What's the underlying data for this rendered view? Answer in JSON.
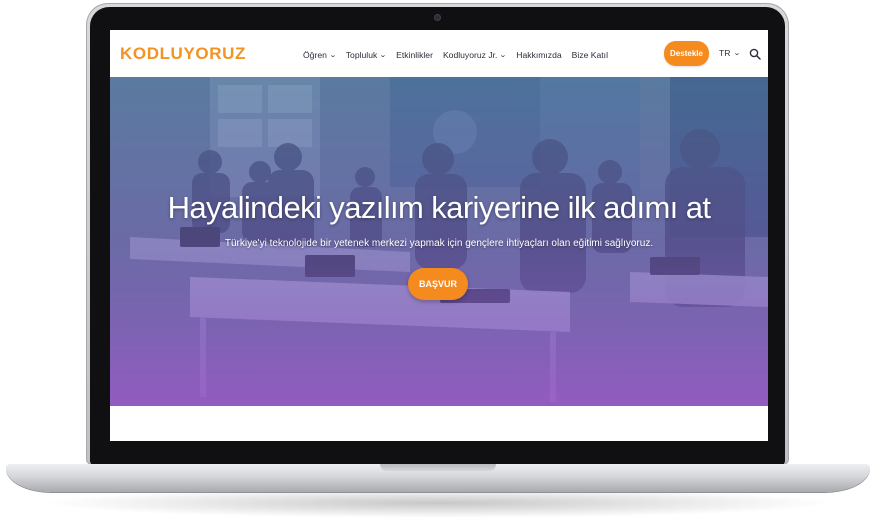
{
  "site": {
    "logo_text": "KODLUYORUZ",
    "brand_color": "#f39322"
  },
  "nav": {
    "items": [
      {
        "label": "Öğren",
        "has_dropdown": true
      },
      {
        "label": "Topluluk",
        "has_dropdown": true
      },
      {
        "label": "Etkinlikler",
        "has_dropdown": false
      },
      {
        "label": "Kodluyoruz Jr.",
        "has_dropdown": true
      },
      {
        "label": "Hakkımızda",
        "has_dropdown": false
      },
      {
        "label": "Bize Katıl",
        "has_dropdown": false
      }
    ],
    "support_button": "Destekle",
    "language": "TR",
    "search_icon": "search-icon"
  },
  "hero": {
    "title": "Hayalindeki yazılım kariyerine ilk adımı at",
    "subtitle": "Türkiye'yi teknolojide bir yetenek merkezi yapmak için gençlere ihtiyaçları olan eğitimi sağlıyoruz.",
    "cta_button": "BAŞVUR",
    "accent_color": "#f58a1f"
  }
}
